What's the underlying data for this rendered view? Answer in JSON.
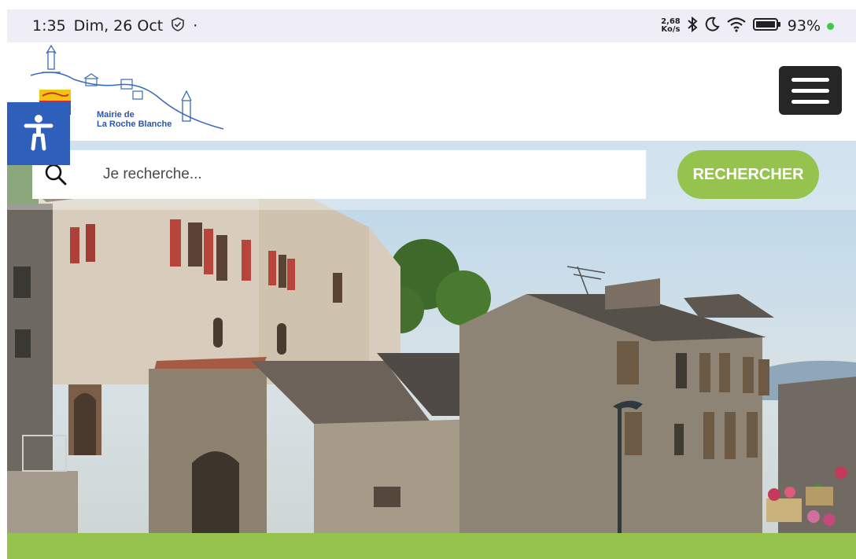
{
  "status_bar": {
    "time": "1:35",
    "date": "Dim, 26 Oct",
    "net_speed_value": "2,68",
    "net_speed_unit": "Ko/s",
    "battery": "93%"
  },
  "header": {
    "logo_line1": "Mairie de",
    "logo_line2": "La Roche Blanche"
  },
  "search": {
    "placeholder": "Je recherche...",
    "button_label": "RECHERCHER"
  },
  "colors": {
    "accent_green": "#95c34e",
    "accessibility_blue": "#2e5fba",
    "menu_dark": "#262626"
  },
  "icons": [
    "shield-check-icon",
    "bluetooth-icon",
    "moon-icon",
    "wifi-icon",
    "battery-icon",
    "search-icon",
    "hamburger-menu-icon",
    "accessibility-icon"
  ]
}
